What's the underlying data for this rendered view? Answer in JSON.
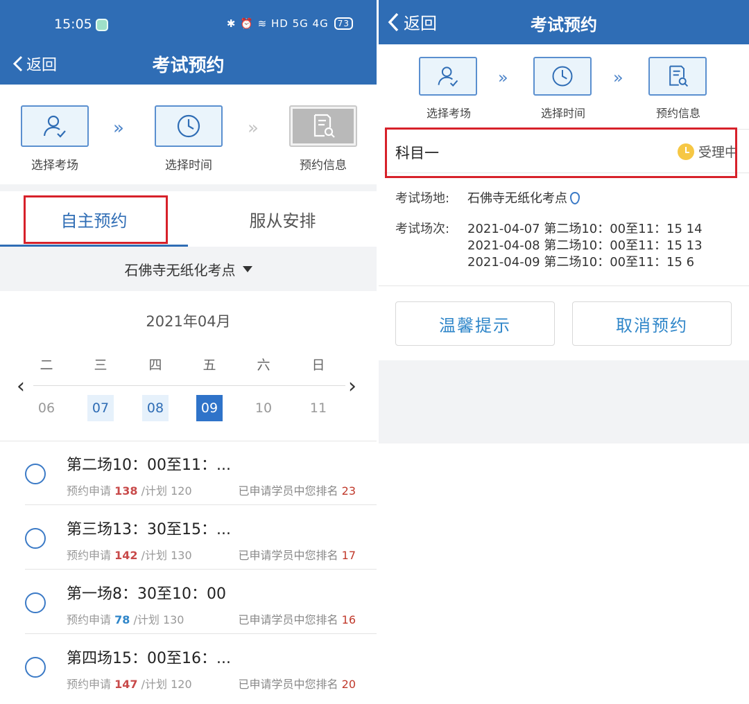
{
  "left": {
    "statusbar": {
      "time": "15:05",
      "icons": "✱ ⏰ ≋ HD 5G 4G",
      "battery": "73"
    },
    "nav": {
      "back": "返回",
      "title": "考试预约"
    },
    "steps": [
      "选择考场",
      "选择时间",
      "预约信息"
    ],
    "tabs": {
      "active": "自主预约",
      "inactive": "服从安排"
    },
    "venue": "石佛寺无纸化考点",
    "calendar": {
      "month": "2021年04月",
      "weekdays": [
        "二",
        "三",
        "四",
        "五",
        "六",
        "日"
      ],
      "dates": [
        "06",
        "07",
        "08",
        "09",
        "10",
        "11"
      ]
    },
    "sessions": [
      {
        "name": "第二场10：00至11：...",
        "applied_label": "预约申请",
        "applied": "138",
        "plan": "/计划 120",
        "rank_label": "已申请学员中您排名",
        "rank": "23",
        "color": "#c84a4a"
      },
      {
        "name": "第三场13：30至15：...",
        "applied_label": "预约申请",
        "applied": "142",
        "plan": "/计划 130",
        "rank_label": "已申请学员中您排名",
        "rank": "17",
        "color": "#c84a4a"
      },
      {
        "name": "第一场8：30至10：00",
        "applied_label": "预约申请",
        "applied": "78",
        "plan": "/计划 130",
        "rank_label": "已申请学员中您排名",
        "rank": "16",
        "color": "#2f86c9"
      },
      {
        "name": "第四场15：00至16：...",
        "applied_label": "预约申请",
        "applied": "147",
        "plan": "/计划 120",
        "rank_label": "已申请学员中您排名",
        "rank": "20",
        "color": "#c84a4a"
      }
    ]
  },
  "right": {
    "nav": {
      "back": "返回",
      "title": "考试预约"
    },
    "steps": [
      "选择考场",
      "选择时间",
      "预约信息"
    ],
    "subject": "科目一",
    "status": "受理中",
    "venue_label": "考试场地:",
    "venue": "石佛寺无纸化考点",
    "session_label": "考试场次:",
    "sessions": [
      "2021-04-07 第二场10：00至11：15 14",
      "2021-04-08 第二场10：00至11：15 13",
      "2021-04-09 第二场10：00至11：15 6"
    ],
    "buttons": {
      "tips": "温馨提示",
      "cancel": "取消预约"
    }
  },
  "colors": {
    "primary": "#2f6db5",
    "highlight": "#d7212a",
    "accent": "#2f86c9"
  }
}
